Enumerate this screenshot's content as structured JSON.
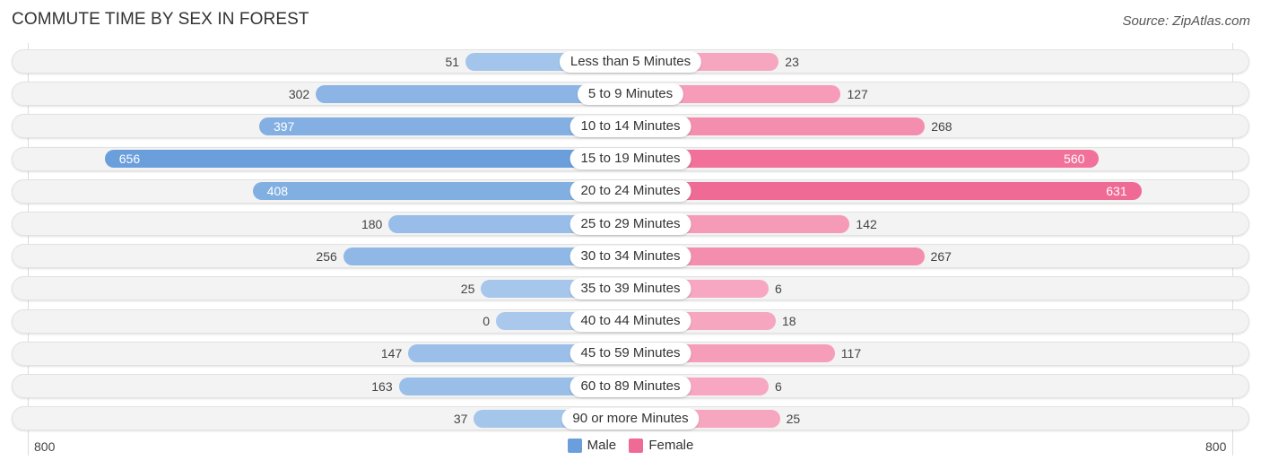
{
  "chart_data": {
    "type": "bar",
    "orientation": "horizontal-diverging",
    "title": "COMMUTE TIME BY SEX IN FOREST",
    "source": "Source: ZipAtlas.com",
    "categories": [
      "Less than 5 Minutes",
      "5 to 9 Minutes",
      "10 to 14 Minutes",
      "15 to 19 Minutes",
      "20 to 24 Minutes",
      "25 to 29 Minutes",
      "30 to 34 Minutes",
      "35 to 39 Minutes",
      "40 to 44 Minutes",
      "45 to 59 Minutes",
      "60 to 89 Minutes",
      "90 or more Minutes"
    ],
    "series": [
      {
        "name": "Male",
        "color": "#6a9fdc",
        "values": [
          51,
          302,
          397,
          656,
          408,
          180,
          256,
          25,
          0,
          147,
          163,
          37
        ]
      },
      {
        "name": "Female",
        "color": "#f06a96",
        "values": [
          23,
          127,
          268,
          560,
          631,
          142,
          267,
          6,
          18,
          117,
          6,
          25
        ]
      }
    ],
    "axis": {
      "left_label": "800",
      "right_label": "800",
      "range": [
        0,
        800
      ]
    },
    "legend": {
      "position": "bottom-center",
      "items": [
        "Male",
        "Female"
      ]
    }
  }
}
